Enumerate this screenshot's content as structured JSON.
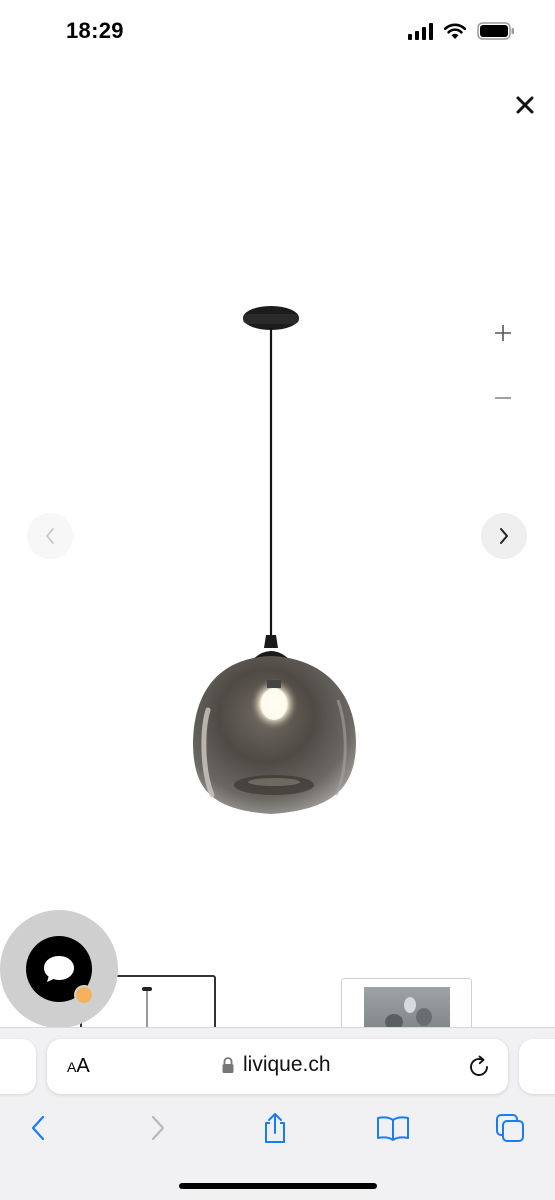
{
  "status_bar": {
    "time": "18:29",
    "icons": [
      "cellular-signal-icon",
      "wifi-icon",
      "battery-icon"
    ]
  },
  "lightbox": {
    "close_icon": "close-icon",
    "zoom_in_icon": "plus-icon",
    "zoom_out_icon": "minus-icon",
    "prev_icon": "chevron-left-icon",
    "next_icon": "chevron-right-icon",
    "image_subject": "smoked glass pendant lamp",
    "thumbnails_count": 2,
    "selected_thumbnail": 1
  },
  "chat": {
    "icon": "chat-bubble-icon",
    "status_color": "#f5b25e"
  },
  "browser": {
    "text_size_label_small": "A",
    "text_size_label_large": "A",
    "url": "livique.ch",
    "lock_icon": "lock-icon",
    "reload_icon": "reload-icon",
    "toolbar": [
      "back-icon",
      "forward-icon",
      "share-icon",
      "bookmarks-icon",
      "tabs-icon"
    ],
    "accent": "#1a7cf5"
  }
}
